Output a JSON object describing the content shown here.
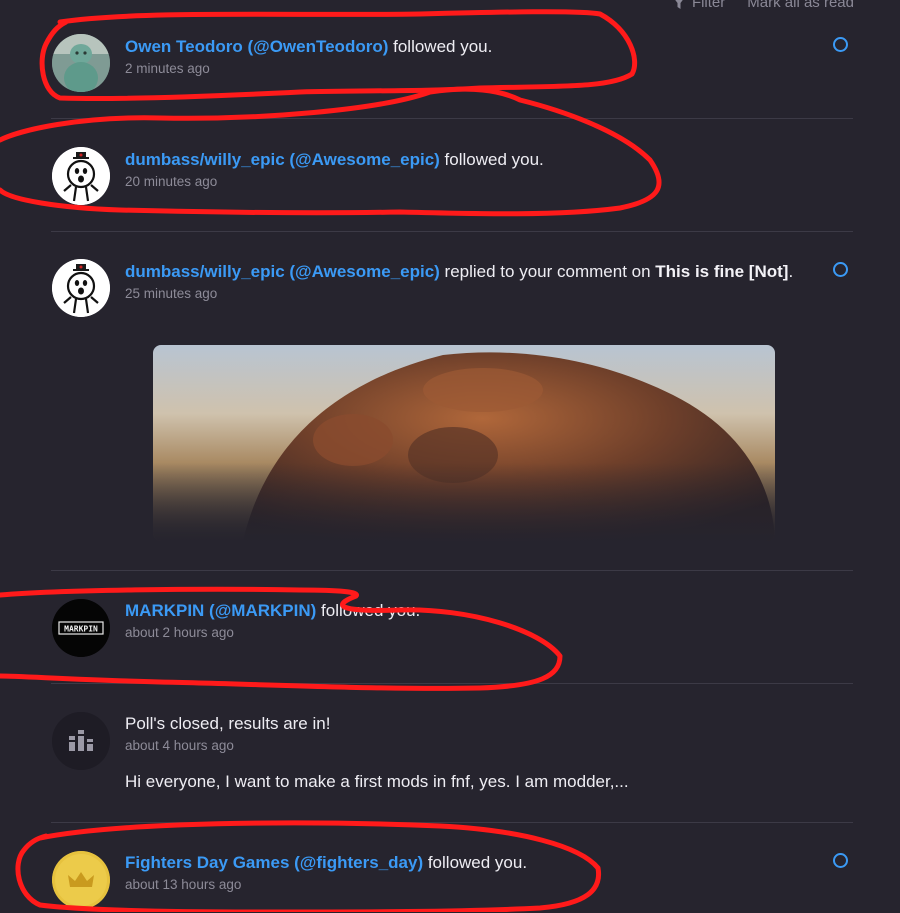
{
  "toolbar": {
    "filter_label": "Filter",
    "mark_all_label": "Mark all as read"
  },
  "notifications": [
    {
      "user": "Owen Teodoro (@OwenTeodoro)",
      "action": " followed you.",
      "time": "2 minutes ago",
      "unread": true
    },
    {
      "user": "dumbass/willy_epic (@Awesome_epic)",
      "action": " followed you.",
      "time": "20 minutes ago",
      "unread": false
    },
    {
      "user": "dumbass/willy_epic (@Awesome_epic)",
      "action": " replied to your comment on ",
      "target": "This is fine [Not]",
      "suffix": ".",
      "time": "25 minutes ago",
      "unread": true
    },
    {
      "user": "MARKPIN (@MARKPIN)",
      "action": " followed you.",
      "time": "about 2 hours ago",
      "unread": false,
      "avatar_text": "MARKPIN"
    },
    {
      "title": "Poll's closed, results are in!",
      "time": "about 4 hours ago",
      "body": "Hi everyone, I want to make a first mods in fnf, yes. I am modder,...",
      "unread": false
    },
    {
      "user": "Fighters Day Games (@fighters_day)",
      "action": " followed you.",
      "time": "about 13 hours ago",
      "unread": true
    }
  ],
  "colors": {
    "background": "#26242e",
    "link": "#3b9af5",
    "divider": "#3c3a46",
    "annotation": "#ff1a1a"
  }
}
